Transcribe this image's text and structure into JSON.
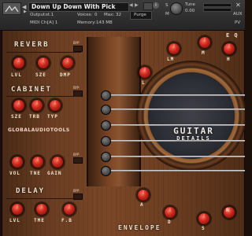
{
  "kontakt_header": {
    "instrument_name": "Down Up Down With Pick",
    "output_label": "Output:",
    "output_value": "st.1",
    "voices_label": "Voices:",
    "voices_value": "0",
    "max_label": "Max:",
    "max_value": "32",
    "purge_label": "Purge",
    "midi_label": "MIDI Ch:",
    "midi_value": "[A] 1",
    "memory_label": "Memory:",
    "memory_value": "143 MB",
    "tune_label": "Tune",
    "tune_value": "0.00",
    "s_label": "S",
    "m_label": "M",
    "aux_label": "AUX",
    "pv_label": "PV"
  },
  "panel": {
    "reverb": {
      "title": "REVERB",
      "knobs": [
        "LVL",
        "SZE",
        "DMP"
      ]
    },
    "cabinet": {
      "title": "CABINET",
      "knobs": [
        "SZE",
        "TRB",
        "TYP"
      ]
    },
    "logo": "GLOBALAUDIOTOOLS",
    "amp": {
      "knobs": [
        "VOL",
        "TNE",
        "GAIN"
      ]
    },
    "delay": {
      "title": "DELAY",
      "knobs": [
        "LVL",
        "TME",
        "F.B"
      ]
    },
    "eq": {
      "title": "E Q",
      "knobs": [
        "L",
        "LM",
        "M",
        "H"
      ]
    },
    "envelope": {
      "title": "ENVELOPE",
      "knobs": [
        "A",
        "D",
        "S",
        "R"
      ]
    },
    "guitar_title": "GUITAR",
    "guitar_subtitle": "DETAILS",
    "toggle_labels": [
      "BYP",
      "BYP",
      "BYP",
      "BYP"
    ]
  },
  "colors": {
    "accent_red": "#c8261a",
    "wood": "#6a3d22",
    "label": "#f1e4cf"
  },
  "icons": [
    "instrument-logo-icon",
    "close-icon",
    "camera-icon",
    "info-icon",
    "tune-knob-icon"
  ]
}
